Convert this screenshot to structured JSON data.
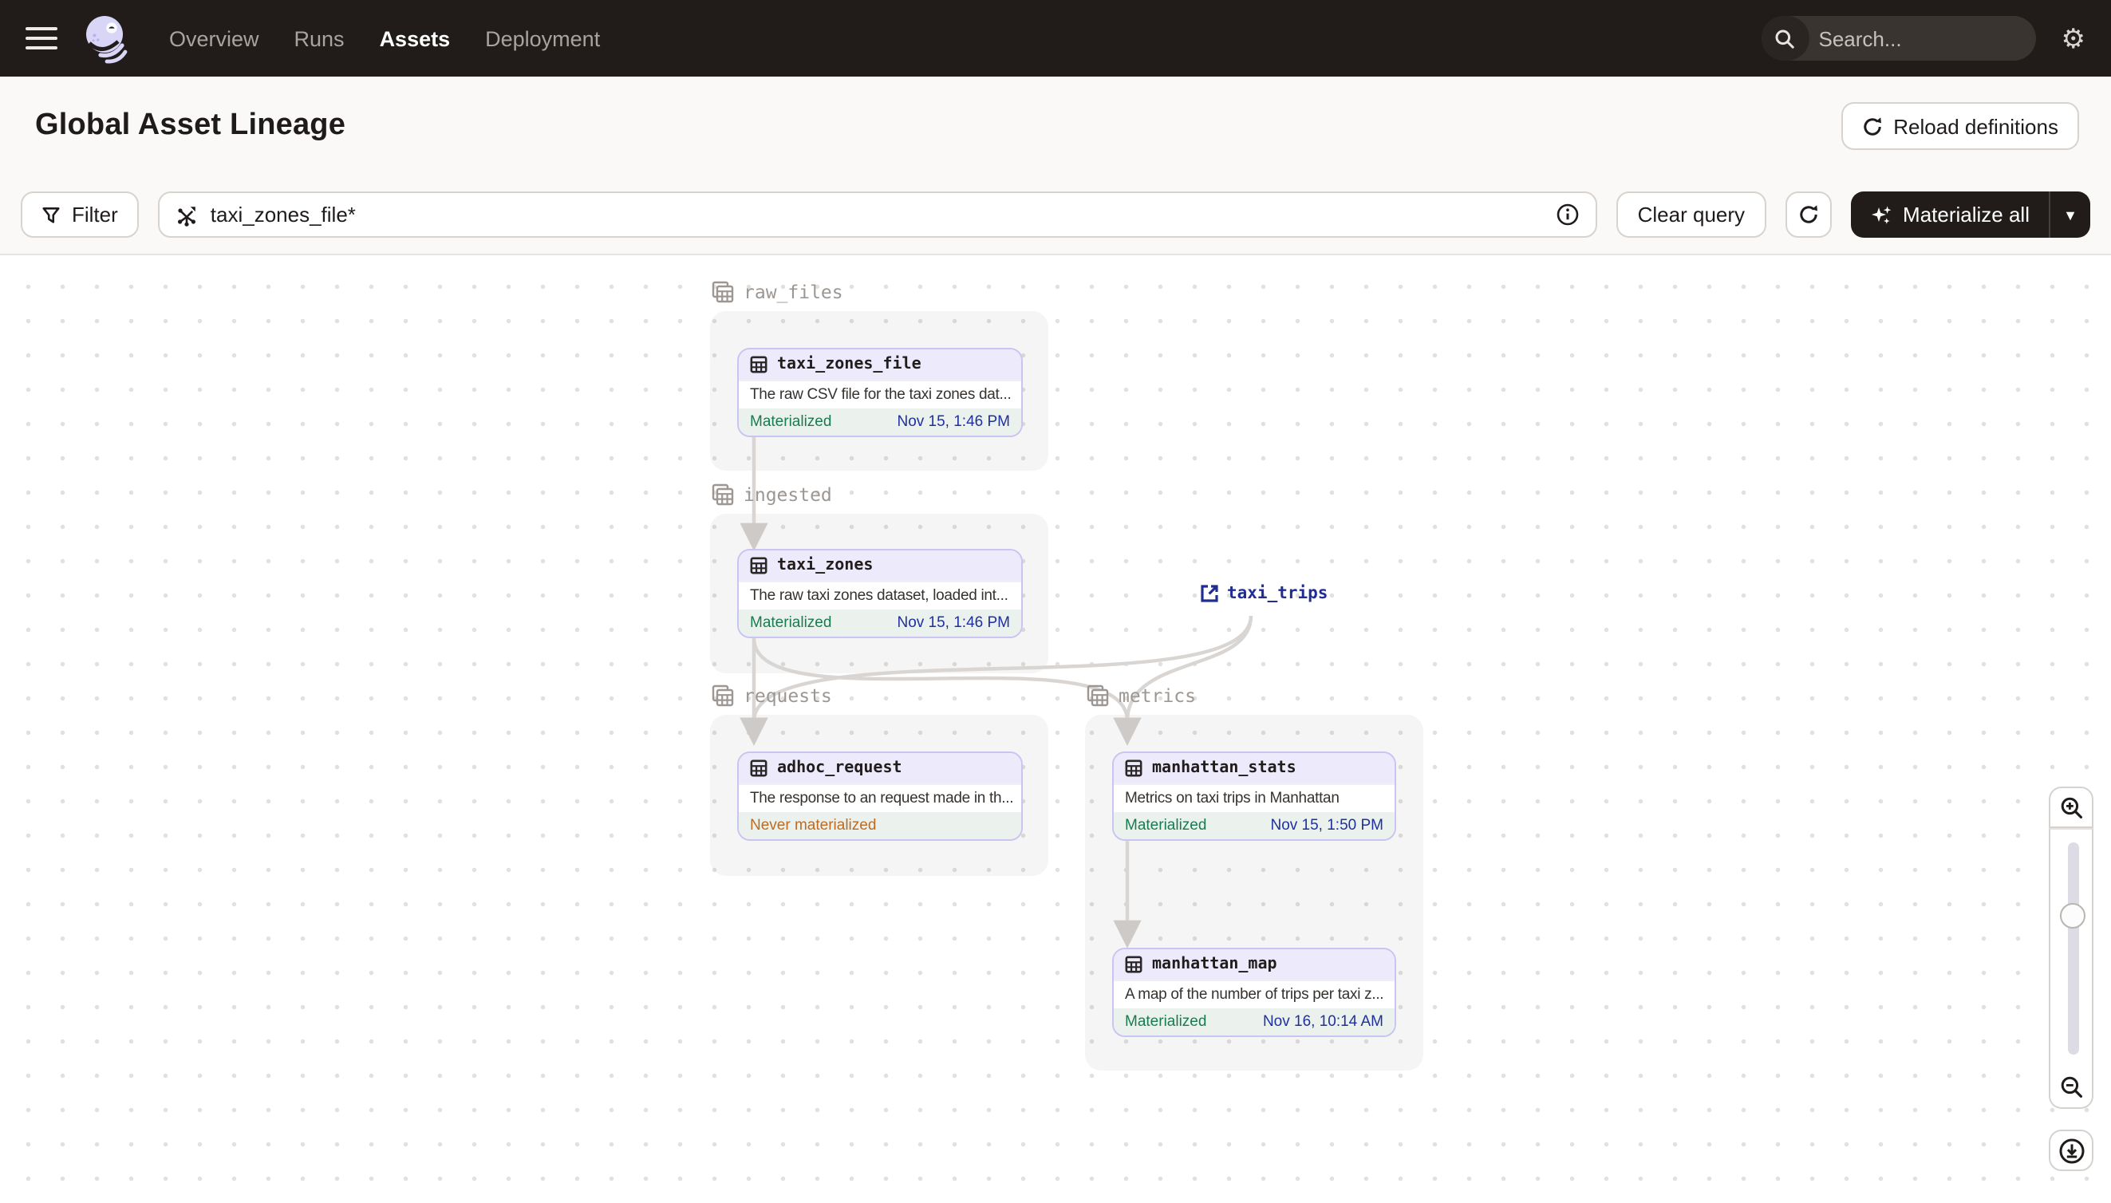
{
  "nav": {
    "menu": [
      {
        "label": "Overview"
      },
      {
        "label": "Runs"
      },
      {
        "label": "Assets"
      },
      {
        "label": "Deployment"
      }
    ],
    "active_item": "Assets",
    "search": {
      "placeholder": "Search...",
      "shortcut": "/"
    }
  },
  "header": {
    "title": "Global Asset Lineage",
    "reload_label": "Reload definitions"
  },
  "toolbar": {
    "filter_label": "Filter",
    "query_value": "taxi_zones_file*",
    "clear_label": "Clear query",
    "materialize_label": "Materialize all"
  },
  "graph": {
    "groups": [
      {
        "label": "raw_files"
      },
      {
        "label": "ingested"
      },
      {
        "label": "requests"
      },
      {
        "label": "metrics"
      }
    ],
    "nodes": [
      {
        "title": "taxi_zones_file",
        "group": "raw_files",
        "description": "The raw CSV file for the taxi zones dat...",
        "status": "Materialized",
        "timestamp": "Nov 15, 1:46 PM"
      },
      {
        "title": "taxi_zones",
        "group": "ingested",
        "description": "The raw taxi zones dataset, loaded int...",
        "status": "Materialized",
        "timestamp": "Nov 15, 1:46 PM"
      },
      {
        "title": "adhoc_request",
        "group": "requests",
        "description": "The response to an request made in th...",
        "status": "Never materialized",
        "timestamp": ""
      },
      {
        "title": "manhattan_stats",
        "group": "metrics",
        "description": "Metrics on taxi trips in Manhattan",
        "status": "Materialized",
        "timestamp": "Nov 15, 1:50 PM"
      },
      {
        "title": "manhattan_map",
        "group": "metrics",
        "description": "A map of the number of trips per taxi z...",
        "status": "Materialized",
        "timestamp": "Nov 16, 10:14 AM"
      }
    ],
    "external": {
      "label": "taxi_trips"
    },
    "edges": [
      {
        "from": "taxi_zones_file",
        "to": "taxi_zones"
      },
      {
        "from": "taxi_zones",
        "to": "adhoc_request"
      },
      {
        "from": "taxi_zones",
        "to": "manhattan_stats"
      },
      {
        "from": "taxi_trips",
        "to": "adhoc_request"
      },
      {
        "from": "taxi_trips",
        "to": "manhattan_stats"
      },
      {
        "from": "manhattan_stats",
        "to": "manhattan_map"
      }
    ]
  },
  "colors": {
    "nav_bg": "#211C1A",
    "band_bg": "#FAF9F7",
    "node_border": "#C9C4F1",
    "node_header_bg": "#ECEAFB",
    "footer_bg": "#EBF2ED",
    "status_green": "#1A7A50",
    "status_orange": "#BD6B24",
    "timestamp_navy": "#20309E",
    "edge_gray": "#D8D5D2",
    "group_label_gray": "#9C9793"
  }
}
